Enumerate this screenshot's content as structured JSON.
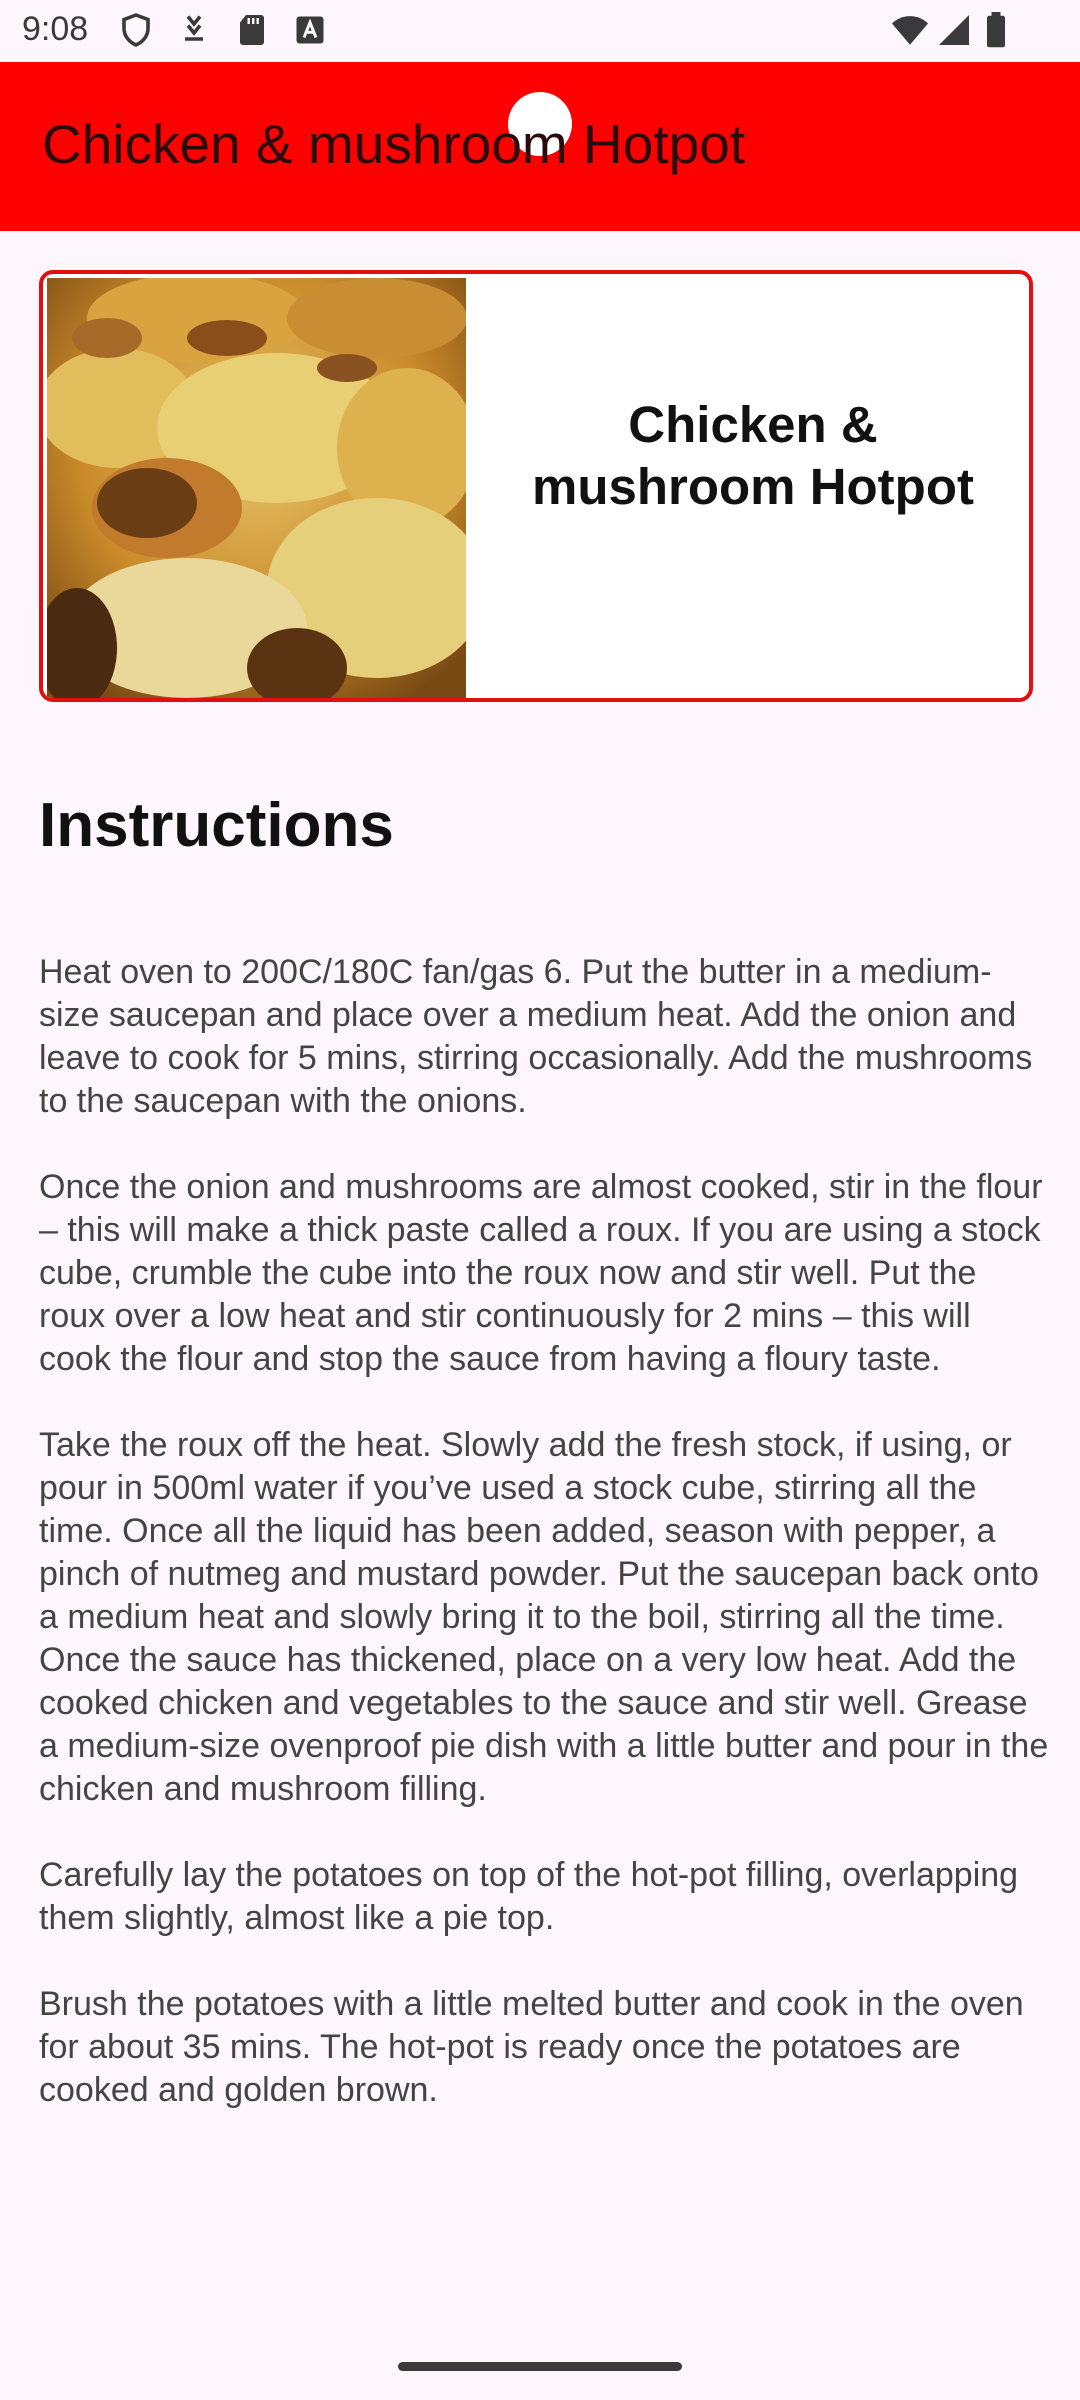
{
  "status_bar": {
    "time": "9:08",
    "left_icons": [
      "shield-icon",
      "download-icon",
      "sd-card-icon",
      "text-icon"
    ],
    "right_icons": [
      "wifi-icon",
      "signal-icon",
      "battery-icon"
    ]
  },
  "app_bar": {
    "title": "Chicken & mushroom Hotpot",
    "background_color": "#ff0000"
  },
  "recipe_card": {
    "name": "Chicken & mushroom Hotpot",
    "border_color": "#e01010",
    "image_alt": "hotpot-photo"
  },
  "instructions": {
    "heading": "Instructions",
    "paragraphs": [
      "Heat oven to 200C/180C fan/gas 6. Put the butter in a medium-size saucepan and place over a medium heat. Add the onion and leave to cook for 5 mins, stirring occasionally. Add the mushrooms to the saucepan with the onions.",
      "Once the onion and mushrooms are almost cooked, stir in the flour – this will make a thick paste called a roux. If you are using a stock cube, crumble the cube into the roux now and stir well. Put the roux over a low heat and stir continuously for 2 mins – this will cook the flour and stop the sauce from having a floury taste.",
      "Take the roux off the heat. Slowly add the fresh stock, if using, or pour in 500ml water if you’ve used a stock cube, stirring all the time. Once all the liquid has been added, season with pepper, a pinch of nutmeg and mustard powder. Put the saucepan back onto a medium heat and slowly bring it to the boil, stirring all the time. Once the sauce has thickened, place on a very low heat. Add the cooked chicken and vegetables to the sauce and stir well. Grease a medium-size ovenproof pie dish with a little butter and pour in the chicken and mushroom filling.",
      "Carefully lay the potatoes on top of the hot-pot filling, overlapping them slightly, almost like a pie top.",
      "Brush the potatoes with a little melted butter and cook in the oven for about 35 mins. The hot-pot is ready once the potatoes are cooked and golden brown."
    ]
  }
}
